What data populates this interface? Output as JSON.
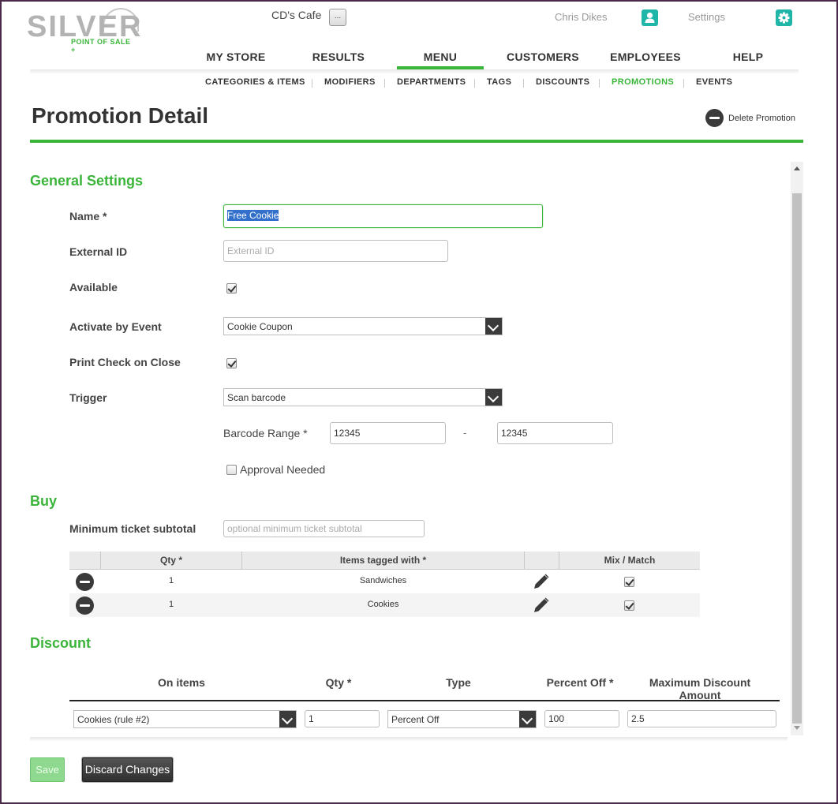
{
  "brand": {
    "name": "SILVER",
    "tagline": "POINT OF SALE +",
    "accent": "#3ab53a",
    "teal": "#1fb5a8"
  },
  "header": {
    "store_name": "CD's Cafe",
    "store_button": "...",
    "user_name": "Chris Dikes",
    "settings_label": "Settings"
  },
  "main_nav": [
    {
      "label": "MY STORE"
    },
    {
      "label": "RESULTS"
    },
    {
      "label": "MENU",
      "active": true
    },
    {
      "label": "CUSTOMERS"
    },
    {
      "label": "EMPLOYEES"
    },
    {
      "label": "HELP"
    }
  ],
  "sub_nav": [
    {
      "label": "CATEGORIES & ITEMS"
    },
    {
      "label": "MODIFIERS"
    },
    {
      "label": "DEPARTMENTS"
    },
    {
      "label": "TAGS"
    },
    {
      "label": "DISCOUNTS"
    },
    {
      "label": "PROMOTIONS",
      "active": true
    },
    {
      "label": "EVENTS"
    }
  ],
  "page": {
    "title": "Promotion Detail",
    "delete_label": "Delete Promotion"
  },
  "general": {
    "heading": "General Settings",
    "name_label": "Name *",
    "name_value": "Free Cookie",
    "external_id_label": "External ID",
    "external_id_placeholder": "External ID",
    "available_label": "Available",
    "available_checked": true,
    "activate_label": "Activate by Event",
    "activate_value": "Cookie Coupon",
    "print_label": "Print Check on Close",
    "print_checked": true,
    "trigger_label": "Trigger",
    "trigger_value": "Scan barcode",
    "barcode_label": "Barcode Range *",
    "barcode_from": "12345",
    "barcode_dash": "-",
    "barcode_to": "12345",
    "approval_label": "Approval Needed",
    "approval_checked": false
  },
  "buy": {
    "heading": "Buy",
    "min_label": "Minimum ticket subtotal",
    "min_placeholder": "optional minimum ticket subtotal",
    "columns": [
      "Qty *",
      "Items tagged with *",
      "Mix / Match"
    ],
    "rows": [
      {
        "qty": "1",
        "tag": "Sandwiches",
        "mix": true
      },
      {
        "qty": "1",
        "tag": "Cookies",
        "mix": true
      }
    ]
  },
  "discount": {
    "heading": "Discount",
    "columns": [
      "On items",
      "Qty *",
      "Type",
      "Percent Off *",
      "Maximum Discount Amount"
    ],
    "row": {
      "on_items": "Cookies (rule #2)",
      "qty": "1",
      "type": "Percent Off",
      "percent_off": "100",
      "max_amount": "2.5"
    }
  },
  "actions": {
    "save": "Save",
    "discard": "Discard Changes"
  }
}
